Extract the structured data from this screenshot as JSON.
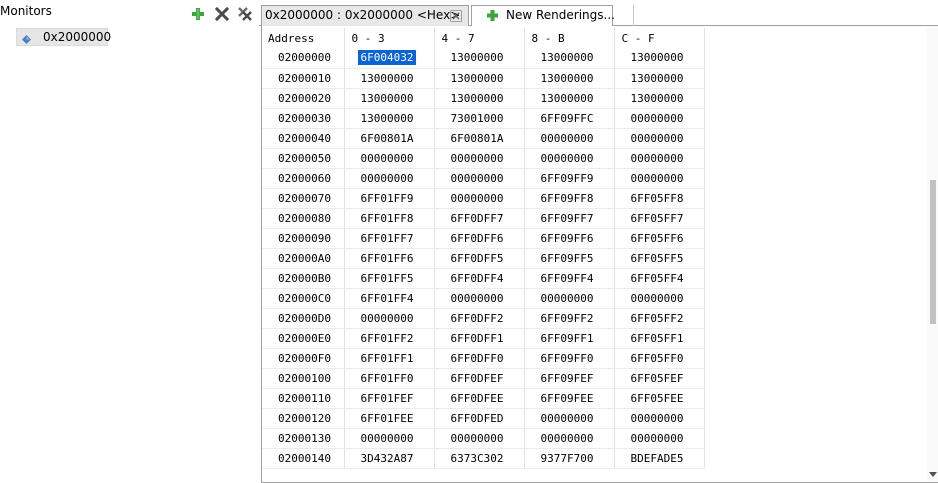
{
  "monitors": {
    "title": "Monitors",
    "items": [
      {
        "label": "0x2000000",
        "icon": "memory-diamond-icon"
      }
    ],
    "toolbar_icons": [
      "add-monitor-icon",
      "remove-monitor-icon",
      "remove-all-monitors-icon"
    ]
  },
  "tabs": [
    {
      "label": "0x2000000 : 0x2000000 <Hex>",
      "icon": "close-icon"
    },
    {
      "label": "New Renderings...",
      "icon": "add-rendering-icon"
    }
  ],
  "hex_view": {
    "headers": [
      "Address",
      "0 - 3",
      "4 - 7",
      "8 - B",
      "C - F"
    ],
    "rows": [
      [
        "02000000",
        "6F004032",
        "13000000",
        "13000000",
        "13000000"
      ],
      [
        "02000010",
        "13000000",
        "13000000",
        "13000000",
        "13000000"
      ],
      [
        "02000020",
        "13000000",
        "13000000",
        "13000000",
        "13000000"
      ],
      [
        "02000030",
        "13000000",
        "73001000",
        "6FF09FFC",
        "00000000"
      ],
      [
        "02000040",
        "6F00801A",
        "6F00801A",
        "00000000",
        "00000000"
      ],
      [
        "02000050",
        "00000000",
        "00000000",
        "00000000",
        "00000000"
      ],
      [
        "02000060",
        "00000000",
        "00000000",
        "6FF09FF9",
        "00000000"
      ],
      [
        "02000070",
        "6FF01FF9",
        "00000000",
        "6FF09FF8",
        "6FF05FF8"
      ],
      [
        "02000080",
        "6FF01FF8",
        "6FF0DFF7",
        "6FF09FF7",
        "6FF05FF7"
      ],
      [
        "02000090",
        "6FF01FF7",
        "6FF0DFF6",
        "6FF09FF6",
        "6FF05FF6"
      ],
      [
        "020000A0",
        "6FF01FF6",
        "6FF0DFF5",
        "6FF09FF5",
        "6FF05FF5"
      ],
      [
        "020000B0",
        "6FF01FF5",
        "6FF0DFF4",
        "6FF09FF4",
        "6FF05FF4"
      ],
      [
        "020000C0",
        "6FF01FF4",
        "00000000",
        "00000000",
        "00000000"
      ],
      [
        "020000D0",
        "00000000",
        "6FF0DFF2",
        "6FF09FF2",
        "6FF05FF2"
      ],
      [
        "020000E0",
        "6FF01FF2",
        "6FF0DFF1",
        "6FF09FF1",
        "6FF05FF1"
      ],
      [
        "020000F0",
        "6FF01FF1",
        "6FF0DFF0",
        "6FF09FF0",
        "6FF05FF0"
      ],
      [
        "02000100",
        "6FF01FF0",
        "6FF0DFEF",
        "6FF09FEF",
        "6FF05FEF"
      ],
      [
        "02000110",
        "6FF01FEF",
        "6FF0DFEE",
        "6FF09FEE",
        "6FF05FEE"
      ],
      [
        "02000120",
        "6FF01FEE",
        "6FF0DFED",
        "00000000",
        "00000000"
      ],
      [
        "02000130",
        "00000000",
        "00000000",
        "00000000",
        "00000000"
      ],
      [
        "02000140",
        "3D432A87",
        "6373C302",
        "9377F700",
        "BDEFADE5"
      ]
    ],
    "selected_cell": {
      "row": 0,
      "col": 1
    }
  },
  "colors": {
    "selection": "#0a64d2",
    "add_icon": "#3aa63a",
    "remove_icon": "#4a4a4a",
    "monitor_icon": "#4a7fc1"
  }
}
